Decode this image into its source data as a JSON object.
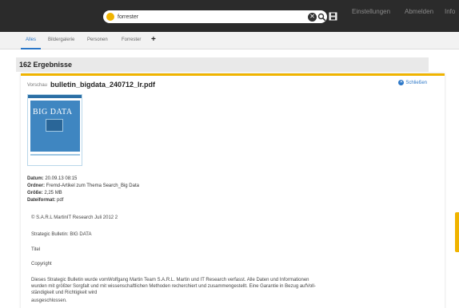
{
  "search": {
    "query": "forrester"
  },
  "topnav": {
    "settings": "Einstellungen",
    "logout": "Abmelden",
    "info": "Info"
  },
  "tabs": [
    "Alles",
    "Bildergalerie",
    "Personen",
    "Forrester"
  ],
  "tab_add": "+",
  "results": {
    "count_label": "162 Ergebnisse"
  },
  "preview": {
    "label": "Vorschau",
    "filename": "bulletin_bigdata_240712_lr.pdf",
    "close_label": "Schließen",
    "thumb_title": "BIG DATA",
    "meta": {
      "date_label": "Datum:",
      "date_value": "20.09.13 08:15",
      "folder_label": "Ordner:",
      "folder_value": "Fremd-Artikel zum Thema Search_Big Data",
      "size_label": "Größe:",
      "size_value": "2,25 MB",
      "format_label": "Dateiformat:",
      "format_value": "pdf"
    },
    "lines": {
      "copyright": "© S.A.R.L MartinIT Research Juli 2012 2",
      "bulletin": "Strategic Bulletin: BIG DATA",
      "titel": "Titel",
      "copyright_head": "Copyright",
      "para1": "Dieses Strategic Bulletin wurde vomWolfgang Martin Team S.A.R.L. Martin und IT Research verfasst. Alle Daten und Informationen",
      "para2": "wurden mit größter Sorgfalt und mit wissenschaftlichen Methoden recherchiert und zusammengestellt. Eine Garantie in Bezug aufVoll-",
      "para3": "ständigkeit und Richtigkeit wird",
      "para4": "ausgeschlossen."
    }
  },
  "colors": {
    "accent": "#f0b400",
    "link": "#2a76c7",
    "topbar": "#2b2b2b"
  },
  "icons": [
    "search-token-icon",
    "clear-icon",
    "search-icon",
    "save-icon",
    "close-circle-icon"
  ]
}
